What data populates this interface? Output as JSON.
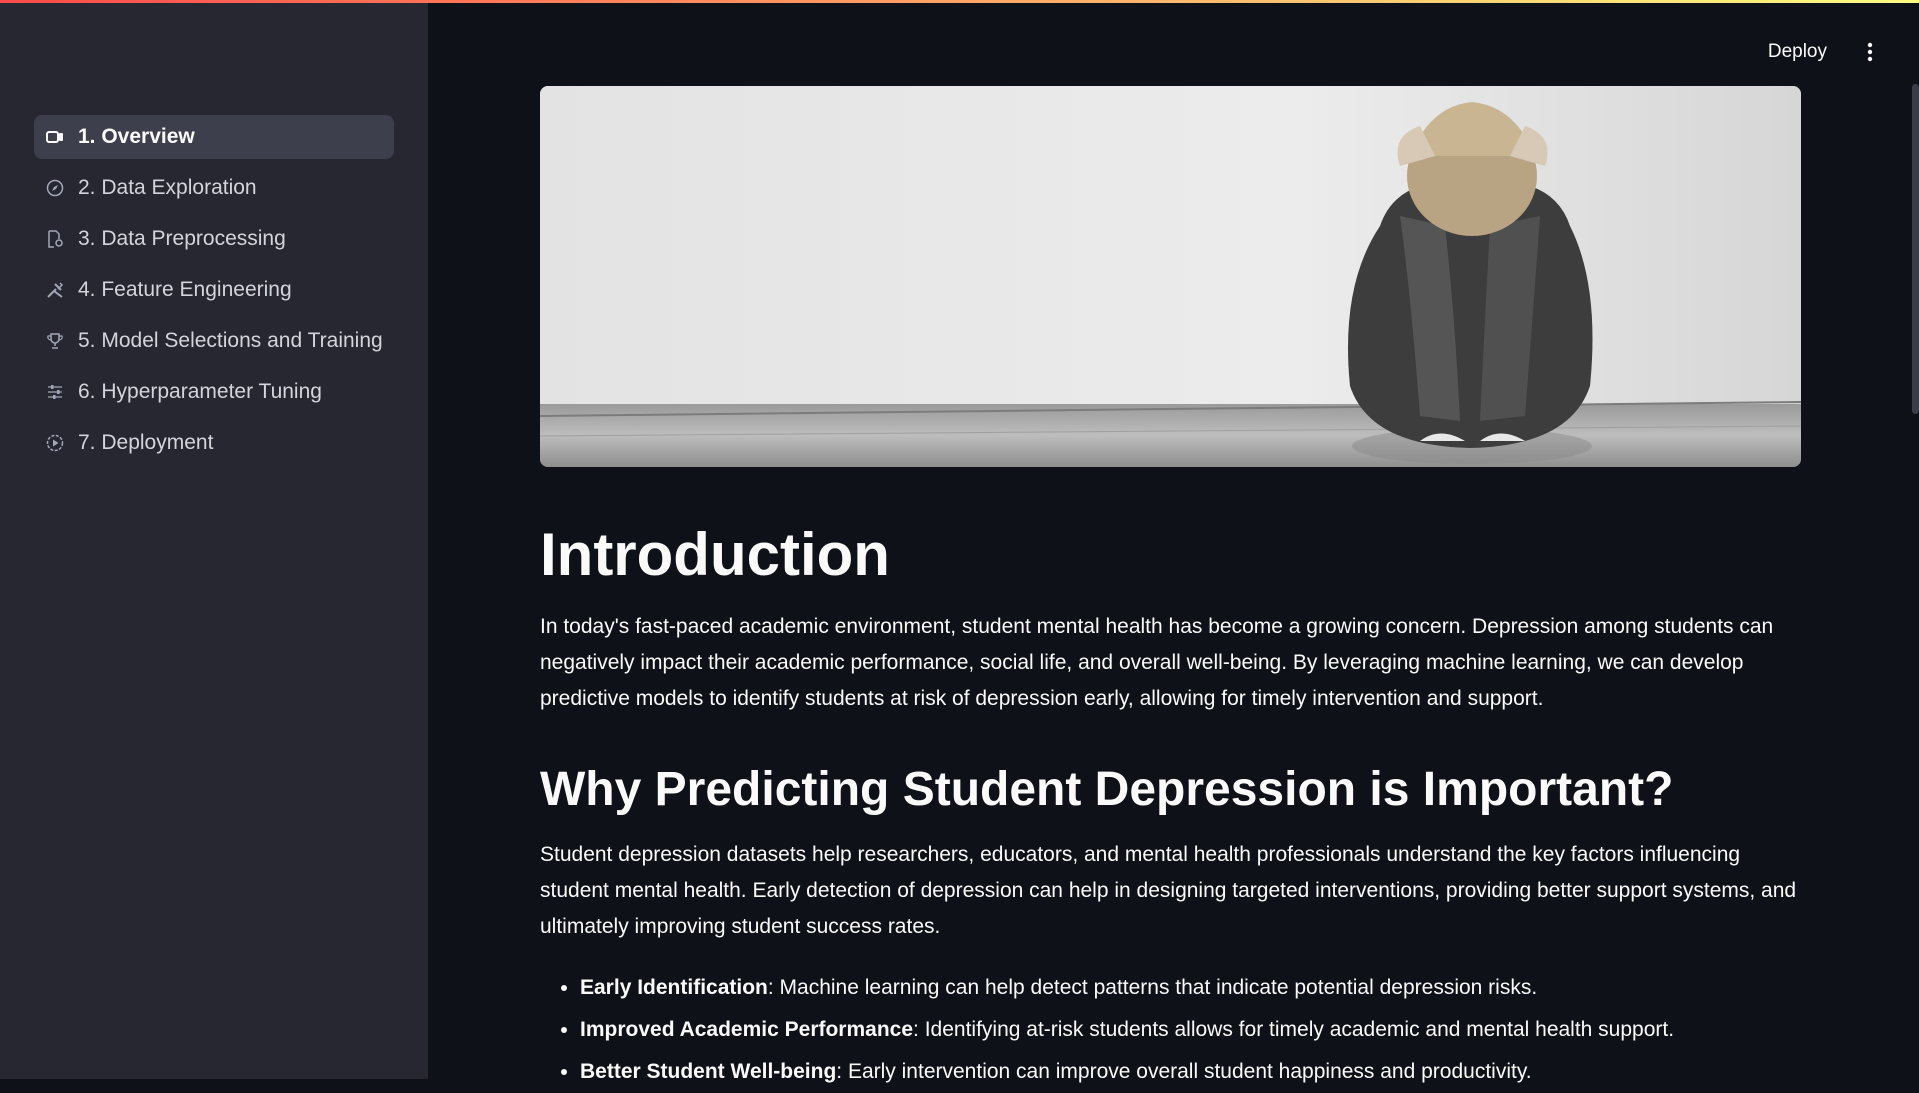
{
  "sidebar": {
    "items": [
      {
        "label": "1. Overview",
        "icon": "video-icon",
        "active": true
      },
      {
        "label": "2. Data Exploration",
        "icon": "compass-icon",
        "active": false
      },
      {
        "label": "3. Data Preprocessing",
        "icon": "document-gear-icon",
        "active": false
      },
      {
        "label": "4. Feature Engineering",
        "icon": "tools-icon",
        "active": false
      },
      {
        "label": "5. Model Selections and Training",
        "icon": "trophy-icon",
        "active": false
      },
      {
        "label": "6. Hyperparameter Tuning",
        "icon": "sliders-icon",
        "active": false
      },
      {
        "label": "7. Deployment",
        "icon": "play-circle-icon",
        "active": false
      }
    ]
  },
  "toolbar": {
    "deploy_label": "Deploy",
    "menu_icon": "vertical-dots-icon"
  },
  "main": {
    "hero_image": "grayscale photo of a person sitting on the floor with head in hands",
    "intro_title": "Introduction",
    "intro_text": "In today's fast-paced academic environment, student mental health has become a growing concern. Depression among students can negatively impact their academic performance, social life, and overall well-being. By leveraging machine learning, we can develop predictive models to identify students at risk of depression early, allowing for timely intervention and support.",
    "why_title": "Why Predicting Student Depression is Important?",
    "why_text": "Student depression datasets help researchers, educators, and mental health professionals understand the key factors influencing student mental health. Early detection of depression can help in designing targeted interventions, providing better support systems, and ultimately improving student success rates.",
    "bullets": [
      {
        "term": "Early Identification",
        "text": ": Machine learning can help detect patterns that indicate potential depression risks."
      },
      {
        "term": "Improved Academic Performance",
        "text": ": Identifying at-risk students allows for timely academic and mental health support."
      },
      {
        "term": "Better Student Well-being",
        "text": ": Early intervention can improve overall student happiness and productivity."
      }
    ]
  },
  "colors": {
    "background": "#0e1117",
    "sidebar": "#262730",
    "active_item": "#3d3f4c",
    "text": "#fafafa"
  }
}
